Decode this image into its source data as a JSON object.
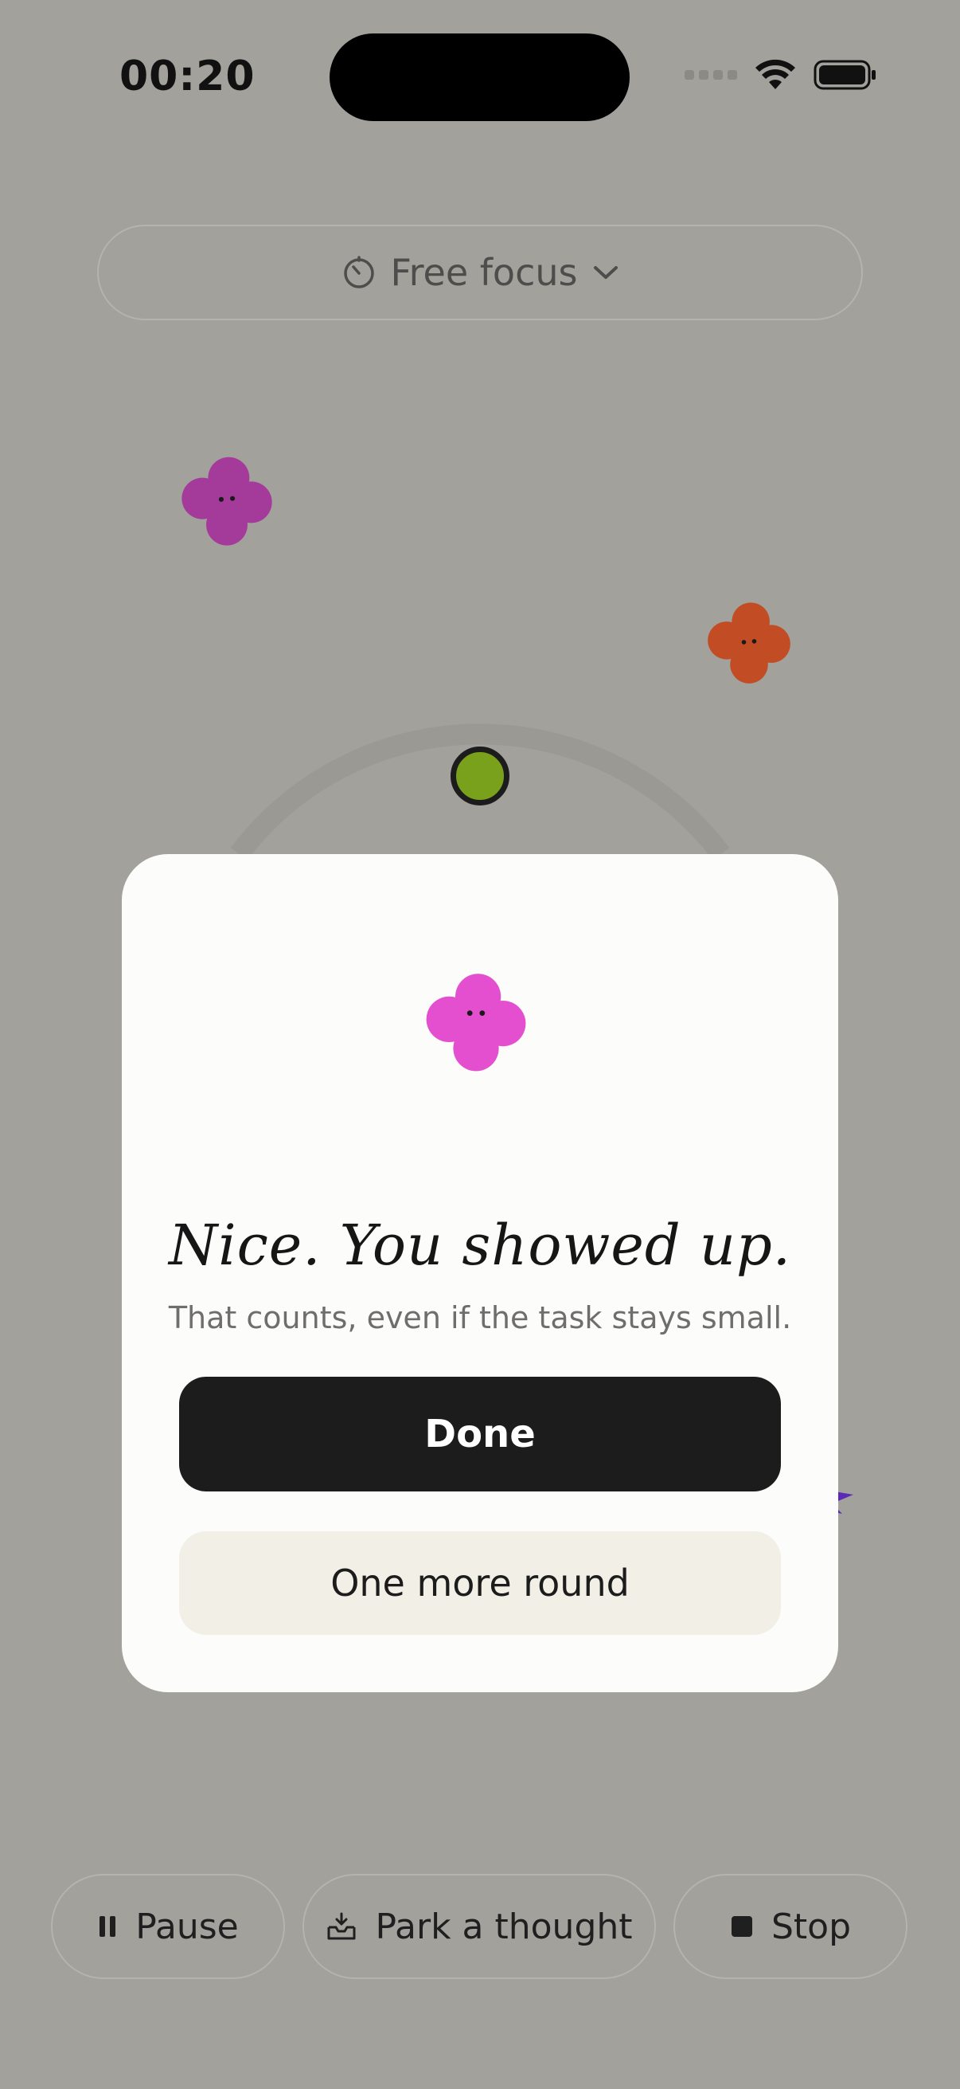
{
  "status_bar": {
    "time": "00:20",
    "icons": [
      "cellular-signal-icon",
      "wifi-icon",
      "battery-icon"
    ]
  },
  "mode_selector": {
    "label": "Free focus",
    "icon": "timer-icon",
    "chevron": "chevron-down-icon"
  },
  "decor": {
    "blob_colors": [
      "#a43a99",
      "#c24d24",
      "#e44fcf"
    ],
    "progress_knob_color": "#7aa11b"
  },
  "modal": {
    "title": "Nice. You showed up.",
    "subtitle": "That counts, even if the task stays small.",
    "primary_button": "Done",
    "secondary_button": "One more round"
  },
  "bottom_bar": {
    "pause_label": "Pause",
    "park_label": "Park a thought",
    "stop_label": "Stop"
  },
  "colors": {
    "background": "#a2a19c",
    "modal_bg": "#fcfcfa",
    "primary_button_bg": "#1c1c1c",
    "secondary_button_bg": "#f1efe6"
  }
}
